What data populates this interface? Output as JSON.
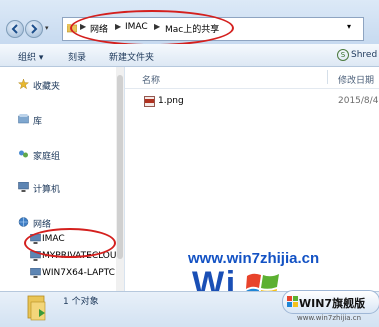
{
  "address_bar": {
    "breadcrumbs": [
      "网络",
      "IMAC",
      "Mac上的共享"
    ],
    "right_hint": "▾"
  },
  "toolbar": {
    "organize": "组织 ▾",
    "burn": "刻录",
    "new_folder": "新建文件夹",
    "shred": "Shred"
  },
  "sidebar": {
    "items": [
      {
        "label": "收藏夹",
        "icon": "star-icon"
      },
      {
        "label": "库",
        "icon": "library-icon"
      },
      {
        "label": "家庭组",
        "icon": "homegroup-icon"
      },
      {
        "label": "计算机",
        "icon": "computer-icon"
      },
      {
        "label": "网络",
        "icon": "network-icon"
      }
    ],
    "network_children": [
      {
        "label": "IMAC",
        "icon": "computer-icon"
      },
      {
        "label": "MYPRIVATECLOU",
        "icon": "computer-icon"
      },
      {
        "label": "WIN7X64-LAPTC",
        "icon": "computer-icon"
      }
    ]
  },
  "content": {
    "columns": [
      "名称",
      "修改日期"
    ],
    "files": [
      {
        "name": "1.png",
        "date": "2015/8/4",
        "icon": "png-file-icon"
      }
    ]
  },
  "status_bar": {
    "count_text": "1 个对象"
  },
  "watermark": {
    "url": "www.win7zhijia.cn",
    "big": "Wi",
    "badge": "WIN7旗舰版",
    "sub": "www.win7zhijia.cn"
  },
  "colors": {
    "annotation_red": "#d4201e",
    "link_blue": "#1352c4"
  }
}
